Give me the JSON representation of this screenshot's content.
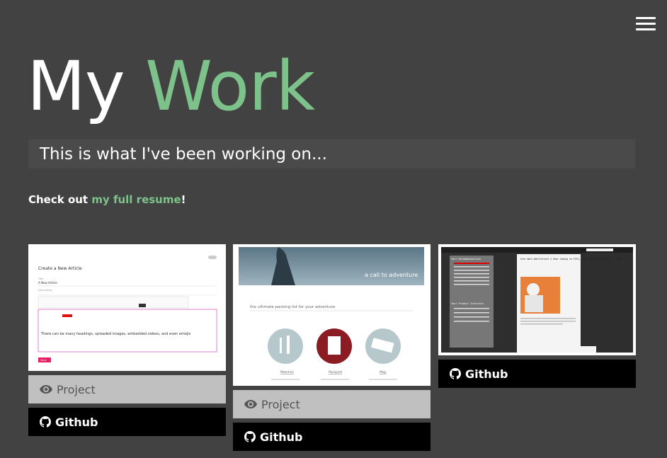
{
  "header": {
    "menu_icon": "hamburger-icon",
    "title_part1": "My",
    "title_part2": "Work",
    "subtitle": "This is what I've been working on...",
    "resume_prefix": "Check out ",
    "resume_link": "my full resume",
    "resume_suffix": "!"
  },
  "colors": {
    "background": "#424242",
    "accent": "#7dc28a",
    "project_button": "#c0c0c0",
    "github_button": "#000000"
  },
  "projects": [
    {
      "thumbnail": {
        "heading": "Create a New Article",
        "field_title_label": "Title",
        "field_title_value": "A New Article",
        "field_description_label": "Description",
        "editor_body": "There can be many headings, uploaded images, embedded videos, and even emojis",
        "save_label": "Save"
      },
      "project_label": "Project",
      "github_label": "Github"
    },
    {
      "thumbnail": {
        "hero_text": "a call to adventure",
        "subheading": "the ultimate packing list for your adventure",
        "items": [
          "Matches",
          "Passport",
          "Map"
        ]
      },
      "project_label": "Project",
      "github_label": "Github"
    },
    {
      "thumbnail": {
        "headline": "Star Wars Battlefront 2 Gear Coming to FIFA, NBA, NBA, Battlefield 1 - IGN",
        "sidebar_title_1": "Your Recommendations",
        "sidebar_title_2": "Your Product Interests"
      },
      "github_label": "Github"
    }
  ]
}
